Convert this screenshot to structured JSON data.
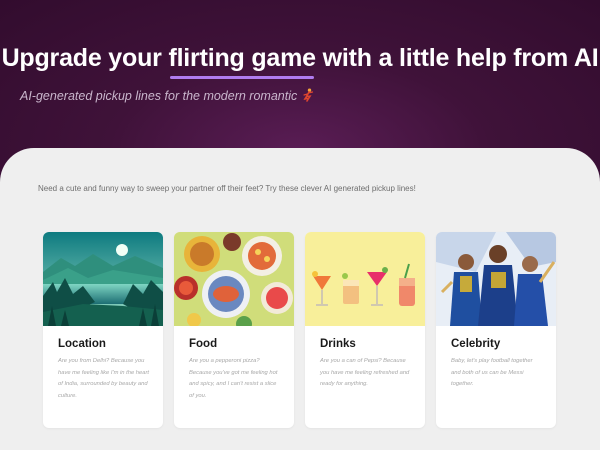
{
  "hero": {
    "title_before": "Upgrade your ",
    "title_highlight": "flirting game",
    "title_after": " with a little help from AI",
    "subtitle": "AI-generated pickup lines for the modern romantic",
    "subtitle_icon": "dancer-icon",
    "colors": {
      "background": "#3a0f36",
      "underline": "#b07cf0"
    }
  },
  "intro": "Need a cute and funny way to sweep your partner off their feet? Try these clever AI generated pickup lines!",
  "cards": [
    {
      "title": "Location",
      "image": "mountain-lake-landscape",
      "text": "Are you from Delhi? Because you have me feeling like I'm in the heart of India, surrounded by beauty and culture."
    },
    {
      "title": "Food",
      "image": "table-of-dishes",
      "text": "Are you a pepperoni pizza? Because you've got me feeling hot and spicy, and I can't resist a slice of you."
    },
    {
      "title": "Drinks",
      "image": "row-of-cocktails",
      "text": "Are you a can of Pepsi? Because you have me feeling refreshed and ready for anything."
    },
    {
      "title": "Celebrity",
      "image": "cricket-players-illustration",
      "text": "Baby, let's play football together and both of us can be Messi together."
    }
  ]
}
